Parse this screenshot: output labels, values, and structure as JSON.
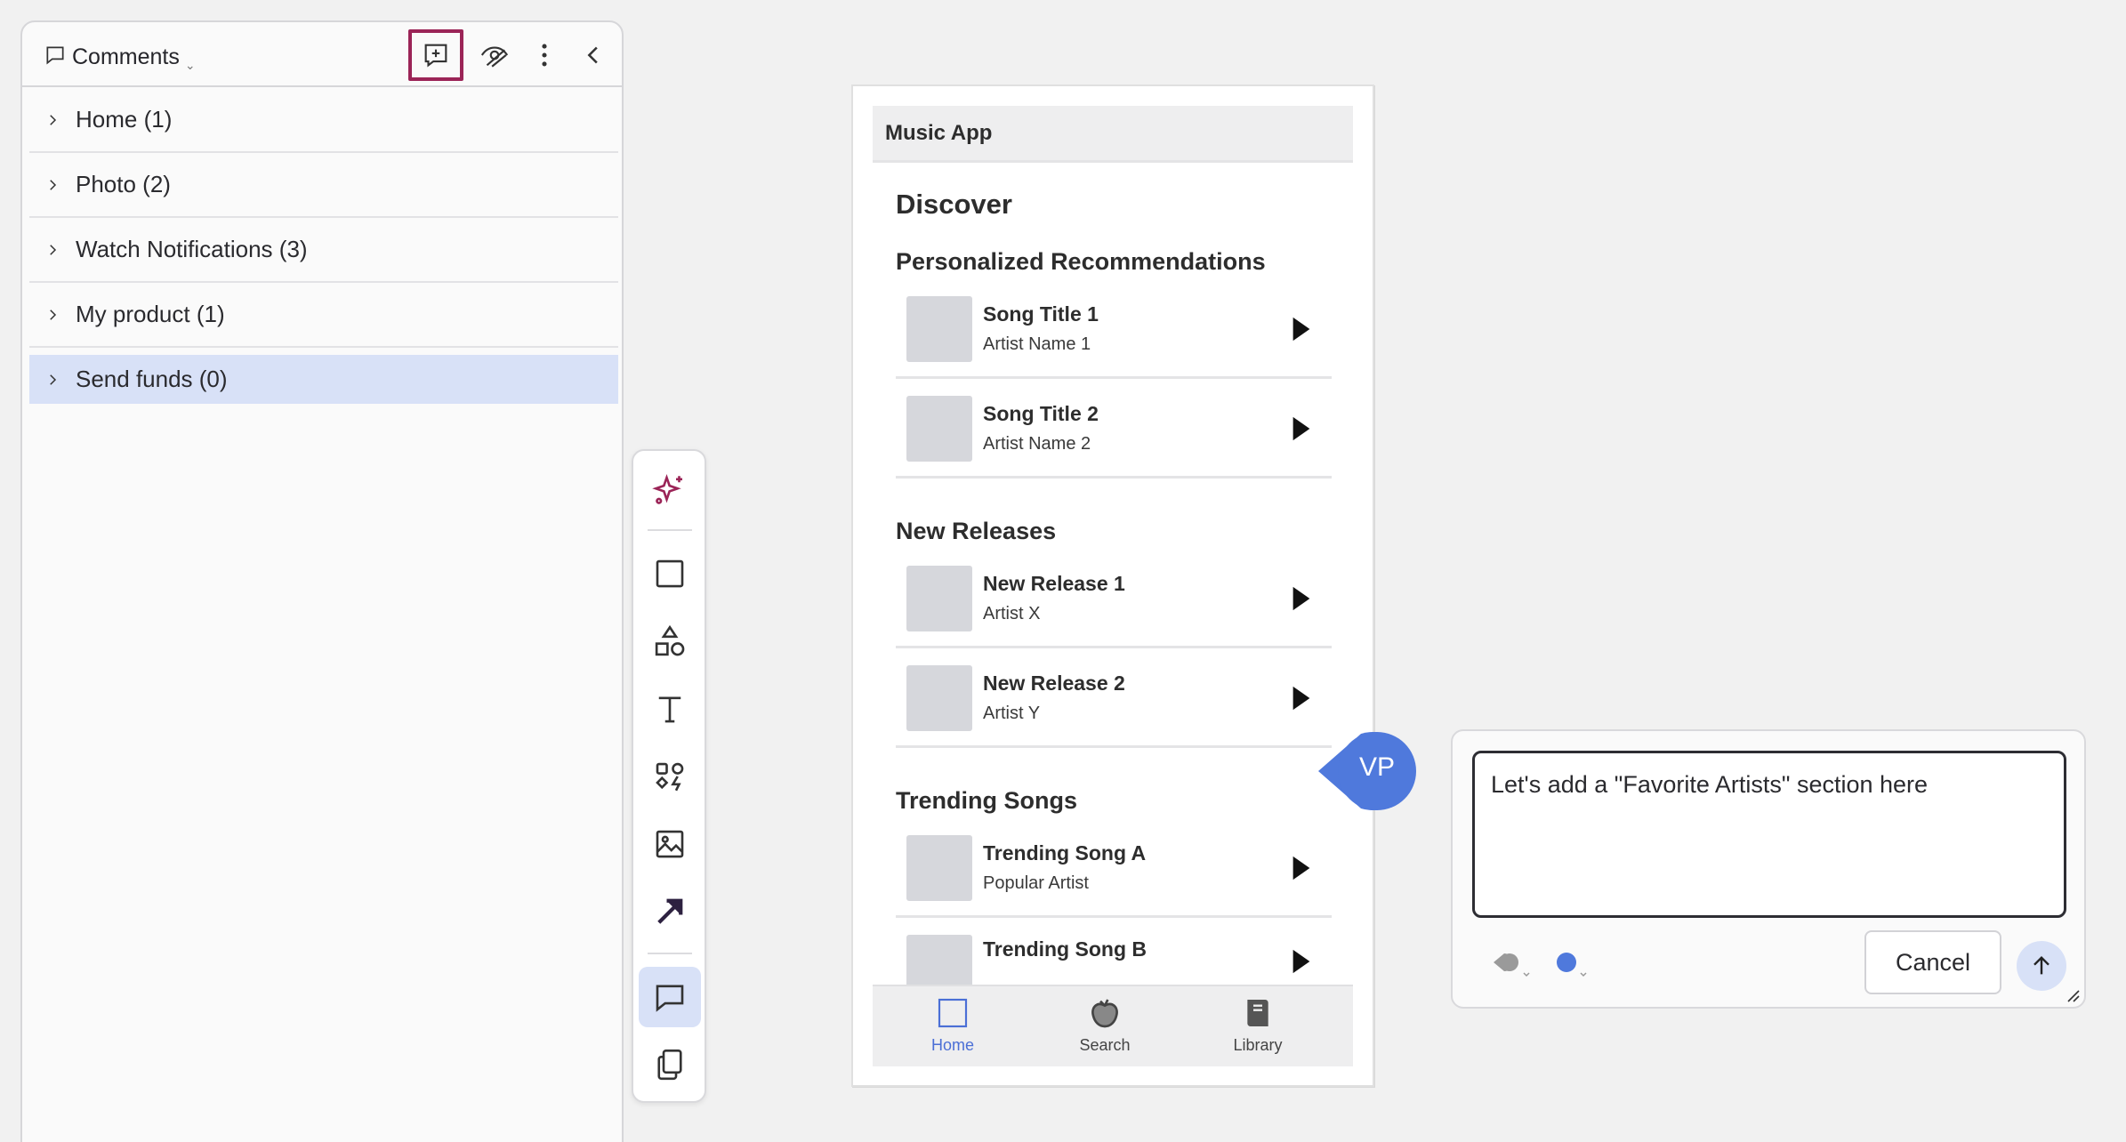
{
  "comments_panel": {
    "title": "Comments",
    "items": [
      {
        "label": "Home (1)"
      },
      {
        "label": "Photo (2)"
      },
      {
        "label": "Watch Notifications (3)"
      },
      {
        "label": "My product (1)"
      },
      {
        "label": "Send funds (0)"
      }
    ],
    "active_item": "Send funds (0)"
  },
  "toolbar": {
    "tools": [
      "ai-sparkle-icon",
      "frame-icon",
      "shapes-icon",
      "text-icon",
      "components-icon",
      "image-icon",
      "arrow-icon",
      "comment-icon",
      "pages-icon"
    ],
    "active_tool": "comment-icon"
  },
  "mockup": {
    "app_title": "Music App",
    "page_heading": "Discover",
    "sections": [
      {
        "heading": "Personalized Recommendations",
        "songs": [
          {
            "title": "Song Title 1",
            "artist": "Artist Name 1"
          },
          {
            "title": "Song Title 2",
            "artist": "Artist Name 2"
          }
        ]
      },
      {
        "heading": "New Releases",
        "songs": [
          {
            "title": "New Release 1",
            "artist": "Artist X"
          },
          {
            "title": "New Release 2",
            "artist": "Artist Y"
          }
        ]
      },
      {
        "heading": "Trending Songs",
        "songs": [
          {
            "title": "Trending Song A",
            "artist": "Popular Artist"
          },
          {
            "title": "Trending Song B",
            "artist": ""
          }
        ]
      }
    ],
    "nav": [
      {
        "label": "Home",
        "icon": "home-icon",
        "active": true
      },
      {
        "label": "Search",
        "icon": "search-icon",
        "active": false
      },
      {
        "label": "Library",
        "icon": "library-icon",
        "active": false
      }
    ]
  },
  "avatar": {
    "initials": "VP",
    "color": "#4f79dc"
  },
  "comment_editor": {
    "value": "Let's add a \"Favorite Artists\" section here",
    "cancel_label": "Cancel",
    "color_dot": "#4f79dc"
  },
  "colors": {
    "accent": "#9b2457",
    "selection": "#d8e1f7",
    "brand_blue": "#4f79dc"
  }
}
